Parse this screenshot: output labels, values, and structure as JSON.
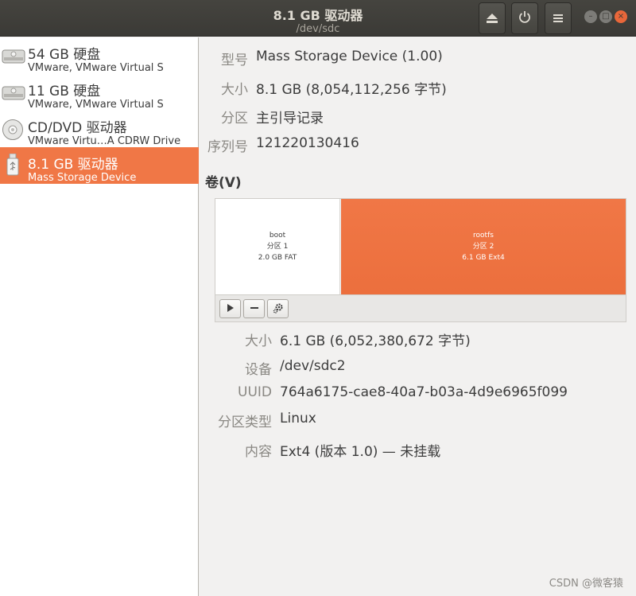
{
  "window": {
    "title": "8.1 GB 驱动器",
    "subtitle": "/dev/sdc"
  },
  "header_buttons": [
    {
      "icon": "eject-icon"
    },
    {
      "icon": "power-icon"
    },
    {
      "icon": "menu-icon"
    }
  ],
  "drives": [
    {
      "name": "54 GB 硬盘",
      "desc": "VMware, VMware Virtual S",
      "icon": "harddisk-icon"
    },
    {
      "name": "11 GB 硬盘",
      "desc": "VMware, VMware Virtual S",
      "icon": "harddisk-icon"
    },
    {
      "name": "CD/DVD 驱动器",
      "desc": "VMware Virtu…A CDRW Drive",
      "icon": "optical-disc-icon"
    },
    {
      "name": "8.1 GB 驱动器",
      "desc": "Mass Storage Device",
      "icon": "usb-drive-icon",
      "selected": true
    }
  ],
  "drive_info": {
    "model_label": "型号",
    "model": "Mass Storage Device (1.00)",
    "size_label": "大小",
    "size": "8.1 GB (8,054,112,256 字节)",
    "partitioning_label": "分区",
    "partitioning": "主引导记录",
    "serial_label": "序列号",
    "serial": "121220130416"
  },
  "volumes": {
    "heading": "卷(V)",
    "partitions": [
      {
        "name": "boot",
        "part": "分区 1",
        "size": "2.0 GB FAT"
      },
      {
        "name": "rootfs",
        "part": "分区 2",
        "size": "6.1 GB Ext4",
        "selected": true
      }
    ]
  },
  "partition_info": {
    "size_label": "大小",
    "size": "6.1 GB (6,052,380,672 字节)",
    "device_label": "设备",
    "device": "/dev/sdc2",
    "uuid_label": "UUID",
    "uuid": "764a6175-cae8-40a7-b03a-4d9e6965f099",
    "type_label": "分区类型",
    "type": "Linux",
    "contents_label": "内容",
    "contents": "Ext4 (版本 1.0) — 未挂载"
  },
  "watermark": "CSDN @微客猿",
  "colors": {
    "accent": "#f07746",
    "titlebar": "#3f3e3a"
  }
}
